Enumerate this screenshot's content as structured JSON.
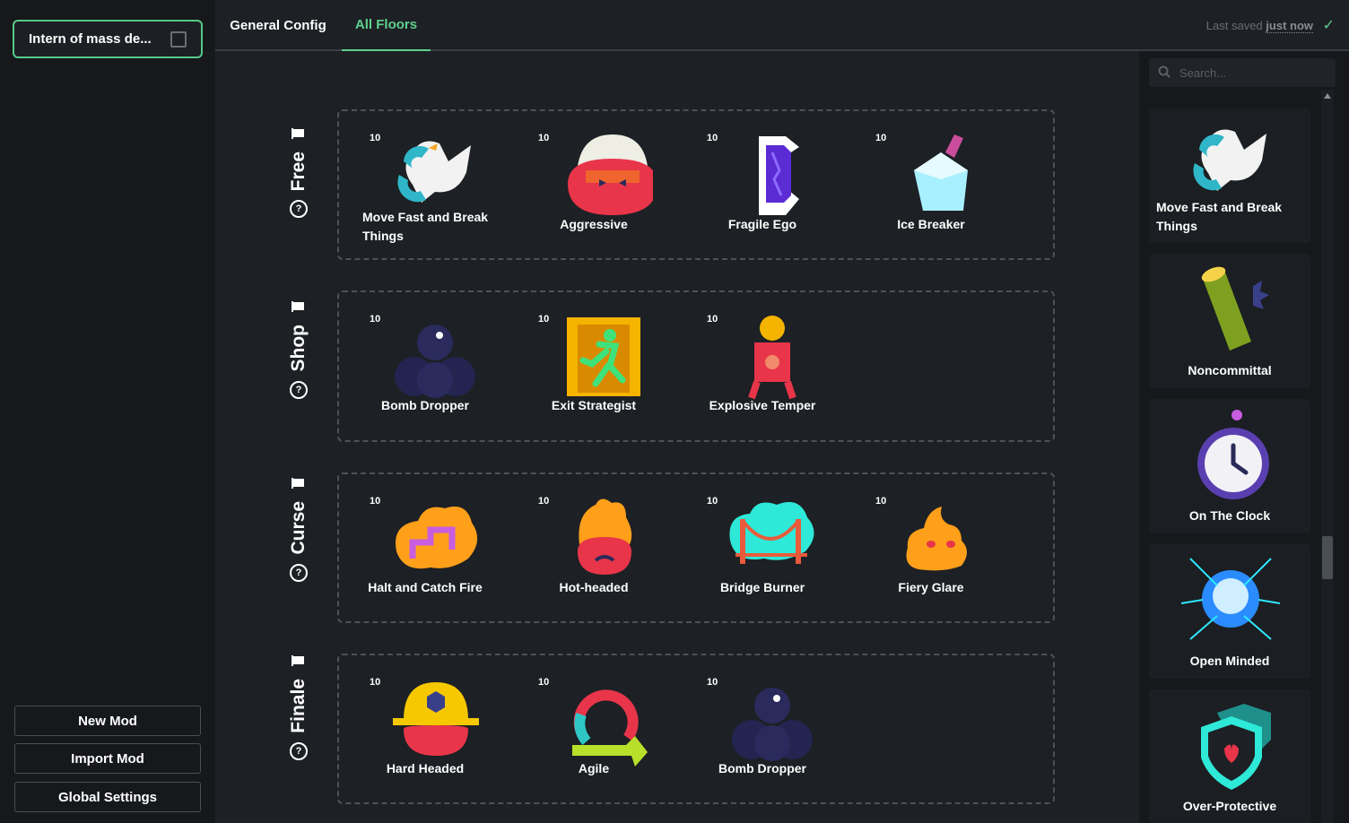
{
  "sidebar": {
    "mod_name": "Intern of mass de...",
    "buttons": {
      "new_mod": "New Mod",
      "import_mod": "Import Mod",
      "global_settings": "Global Settings"
    }
  },
  "header": {
    "tabs": [
      "General Config",
      "All Floors"
    ],
    "active_tab": "All Floors",
    "saved_prefix": "Last saved",
    "saved_time": "just now",
    "accent": "#5fd08d"
  },
  "floors": [
    {
      "name": "Free",
      "items": [
        {
          "level": "10",
          "title": "Move Fast and Break Things",
          "icon": "goose-icon"
        },
        {
          "level": "10",
          "title": "Aggressive",
          "icon": "angry-face-icon"
        },
        {
          "level": "10",
          "title": "Fragile Ego",
          "icon": "cracked-crystal-icon"
        },
        {
          "level": "10",
          "title": "Ice Breaker",
          "icon": "ice-pick-icon"
        }
      ]
    },
    {
      "name": "Shop",
      "items": [
        {
          "level": "10",
          "title": "Bomb Dropper",
          "icon": "bomb-pile-icon"
        },
        {
          "level": "10",
          "title": "Exit Strategist",
          "icon": "exit-runner-icon"
        },
        {
          "level": "10",
          "title": "Explosive Temper",
          "icon": "dynamite-person-icon"
        }
      ]
    },
    {
      "name": "Curse",
      "items": [
        {
          "level": "10",
          "title": "Halt and Catch Fire",
          "icon": "fire-cloud-icon"
        },
        {
          "level": "10",
          "title": "Hot-headed",
          "icon": "flaming-face-icon"
        },
        {
          "level": "10",
          "title": "Bridge Burner",
          "icon": "bridge-icon"
        },
        {
          "level": "10",
          "title": "Fiery Glare",
          "icon": "fire-blob-icon"
        }
      ]
    },
    {
      "name": "Finale",
      "items": [
        {
          "level": "10",
          "title": "Hard Headed",
          "icon": "hardhat-face-icon"
        },
        {
          "level": "10",
          "title": "Agile",
          "icon": "cycle-arrows-icon"
        },
        {
          "level": "10",
          "title": "Bomb Dropper",
          "icon": "bomb-pile-icon"
        }
      ]
    }
  ],
  "library": {
    "search_placeholder": "Search...",
    "items": [
      {
        "title": "Move Fast and Break Things",
        "icon": "goose-icon"
      },
      {
        "title": "Noncommittal",
        "icon": "log-icon"
      },
      {
        "title": "On The Clock",
        "icon": "stopwatch-icon"
      },
      {
        "title": "Open Minded",
        "icon": "glowing-head-icon"
      },
      {
        "title": "Over-Protective",
        "icon": "shield-icon"
      }
    ]
  }
}
